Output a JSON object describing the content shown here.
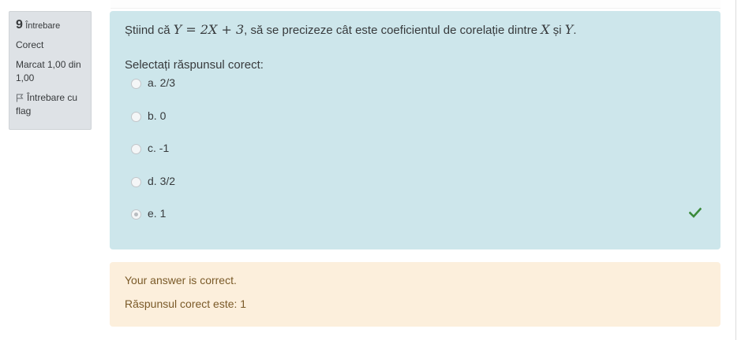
{
  "question": {
    "number": "9",
    "word": "Întrebare",
    "state": "Corect",
    "grade": "Marcat 1,00 din 1,00",
    "flag_label": "Întrebare cu flag",
    "text_parts": {
      "t1": "Știind că ",
      "m1": "Y = 2X + 3",
      "t2": ", să se precizeze cât este coeficientul de corelație dintre ",
      "m2": "X",
      "t3": " și ",
      "m3": "Y",
      "t4": "."
    },
    "prompt": "Selectați răspunsul corect:",
    "answers": [
      {
        "label": "a. 2/3",
        "selected": false
      },
      {
        "label": "b. 0",
        "selected": false
      },
      {
        "label": "c. -1",
        "selected": false
      },
      {
        "label": "d. 3/2",
        "selected": false
      },
      {
        "label": "e. 1",
        "selected": true,
        "correct_icon": "check-icon"
      }
    ]
  },
  "feedback": {
    "general": "Your answer is correct.",
    "right_answer": "Răspunsul corect este: 1"
  },
  "colors": {
    "formulation_bg": "#cde6eb",
    "feedback_bg": "#fcefdc",
    "info_bg": "#dee2e6",
    "check": "#3a8a3a"
  }
}
